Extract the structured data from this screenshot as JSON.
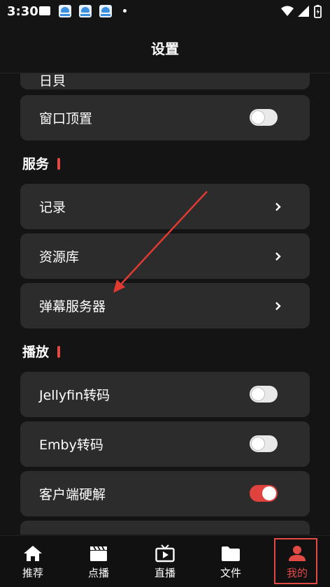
{
  "status_bar": {
    "time": "3:30",
    "mail_icon": "mail-icon",
    "app_icons": [
      "app-notification-icon",
      "app-notification-icon",
      "app-notification-icon"
    ],
    "wifi": "wifi-icon",
    "signal": "signal-icon",
    "battery": "battery-charging-icon"
  },
  "header": {
    "title": "设置"
  },
  "sections": {
    "top_card": {
      "label": "日貝"
    },
    "window_top": {
      "label": "窗口顶置",
      "toggle": "off"
    },
    "services": {
      "title": "服务",
      "items": [
        {
          "label": "记录"
        },
        {
          "label": "资源库"
        },
        {
          "label": "弹幕服务器"
        }
      ]
    },
    "playback": {
      "title": "播放",
      "items": [
        {
          "label": "Jellyfin转码",
          "toggle": "off"
        },
        {
          "label": "Emby转码",
          "toggle": "off"
        },
        {
          "label": "客户端硬解",
          "toggle": "on"
        }
      ]
    }
  },
  "tabs": [
    {
      "label": "推荐",
      "icon": "home-icon"
    },
    {
      "label": "点播",
      "icon": "clapperboard-icon"
    },
    {
      "label": "直播",
      "icon": "tv-icon"
    },
    {
      "label": "文件",
      "icon": "folder-icon"
    },
    {
      "label": "我的",
      "icon": "person-icon",
      "active": true
    }
  ],
  "colors": {
    "accent": "#e34a46",
    "card": "#2c2c2c",
    "background": "#141414"
  }
}
